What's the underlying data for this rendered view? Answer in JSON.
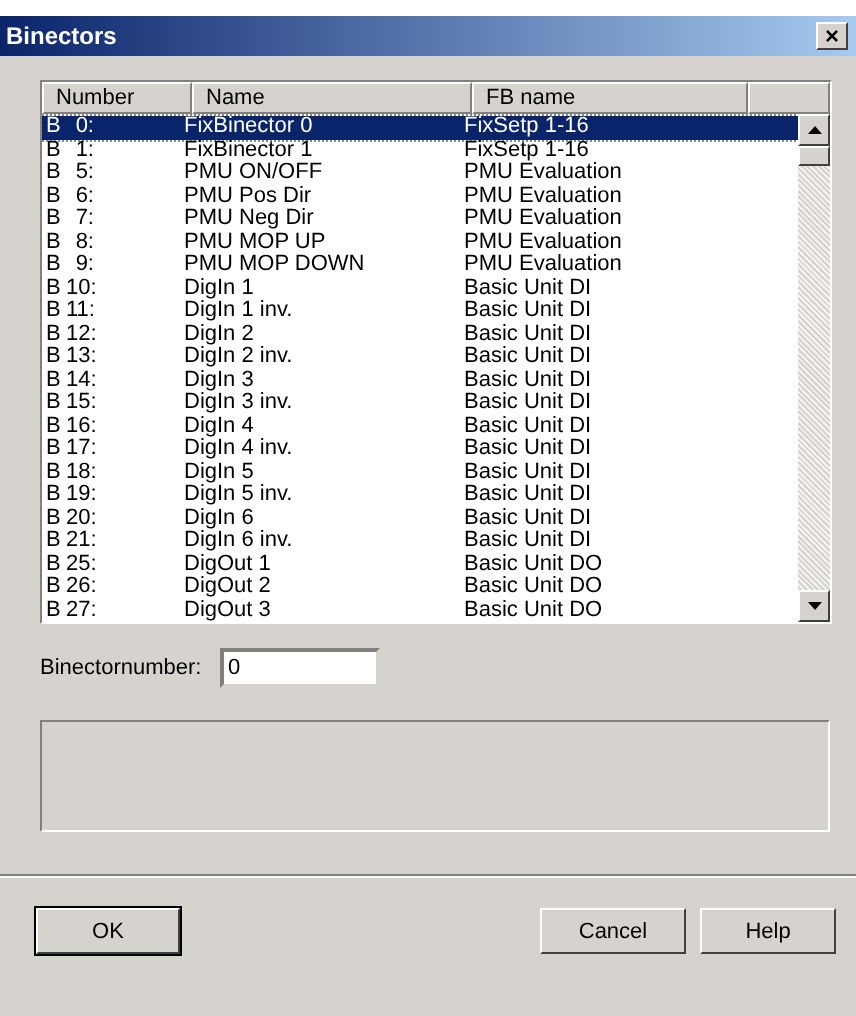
{
  "window": {
    "title": "Binectors",
    "close": "×"
  },
  "table": {
    "columns": [
      "Number",
      "Name",
      "FB name"
    ],
    "rows": [
      {
        "prefix": "B",
        "number": "0:",
        "name": "FixBinector 0",
        "fb_name": "FixSetp 1-16",
        "selected": true
      },
      {
        "prefix": "B",
        "number": "1:",
        "name": "FixBinector 1",
        "fb_name": "FixSetp 1-16",
        "selected": false
      },
      {
        "prefix": "B",
        "number": "5:",
        "name": "PMU ON/OFF",
        "fb_name": "PMU Evaluation",
        "selected": false
      },
      {
        "prefix": "B",
        "number": "6:",
        "name": "PMU Pos Dir",
        "fb_name": "PMU Evaluation",
        "selected": false
      },
      {
        "prefix": "B",
        "number": "7:",
        "name": "PMU Neg Dir",
        "fb_name": "PMU Evaluation",
        "selected": false
      },
      {
        "prefix": "B",
        "number": "8:",
        "name": "PMU MOP UP",
        "fb_name": "PMU Evaluation",
        "selected": false
      },
      {
        "prefix": "B",
        "number": "9:",
        "name": "PMU MOP DOWN",
        "fb_name": "PMU Evaluation",
        "selected": false
      },
      {
        "prefix": "B",
        "number": "10:",
        "name": "DigIn 1",
        "fb_name": "Basic Unit DI",
        "selected": false
      },
      {
        "prefix": "B",
        "number": "11:",
        "name": "DigIn 1 inv.",
        "fb_name": "Basic Unit DI",
        "selected": false
      },
      {
        "prefix": "B",
        "number": "12:",
        "name": "DigIn 2",
        "fb_name": "Basic Unit DI",
        "selected": false
      },
      {
        "prefix": "B",
        "number": "13:",
        "name": "DigIn 2 inv.",
        "fb_name": "Basic Unit DI",
        "selected": false
      },
      {
        "prefix": "B",
        "number": "14:",
        "name": "DigIn 3",
        "fb_name": "Basic Unit DI",
        "selected": false
      },
      {
        "prefix": "B",
        "number": "15:",
        "name": "DigIn 3 inv.",
        "fb_name": "Basic Unit DI",
        "selected": false
      },
      {
        "prefix": "B",
        "number": "16:",
        "name": "DigIn 4",
        "fb_name": "Basic Unit DI",
        "selected": false
      },
      {
        "prefix": "B",
        "number": "17:",
        "name": "DigIn 4 inv.",
        "fb_name": "Basic Unit DI",
        "selected": false
      },
      {
        "prefix": "B",
        "number": "18:",
        "name": "DigIn 5",
        "fb_name": "Basic Unit DI",
        "selected": false
      },
      {
        "prefix": "B",
        "number": "19:",
        "name": "DigIn 5 inv.",
        "fb_name": "Basic Unit DI",
        "selected": false
      },
      {
        "prefix": "B",
        "number": "20:",
        "name": "DigIn 6",
        "fb_name": "Basic Unit DI",
        "selected": false
      },
      {
        "prefix": "B",
        "number": "21:",
        "name": "DigIn 6 inv.",
        "fb_name": "Basic Unit DI",
        "selected": false
      },
      {
        "prefix": "B",
        "number": "25:",
        "name": "DigOut 1",
        "fb_name": "Basic Unit DO",
        "selected": false
      },
      {
        "prefix": "B",
        "number": "26:",
        "name": "DigOut 2",
        "fb_name": "Basic Unit DO",
        "selected": false
      },
      {
        "prefix": "B",
        "number": "27:",
        "name": "DigOut 3",
        "fb_name": "Basic Unit DO",
        "selected": false
      }
    ]
  },
  "binector_number": {
    "label": "Binectornumber:",
    "value": "0"
  },
  "buttons": {
    "ok": "OK",
    "cancel": "Cancel",
    "help": "Help"
  }
}
